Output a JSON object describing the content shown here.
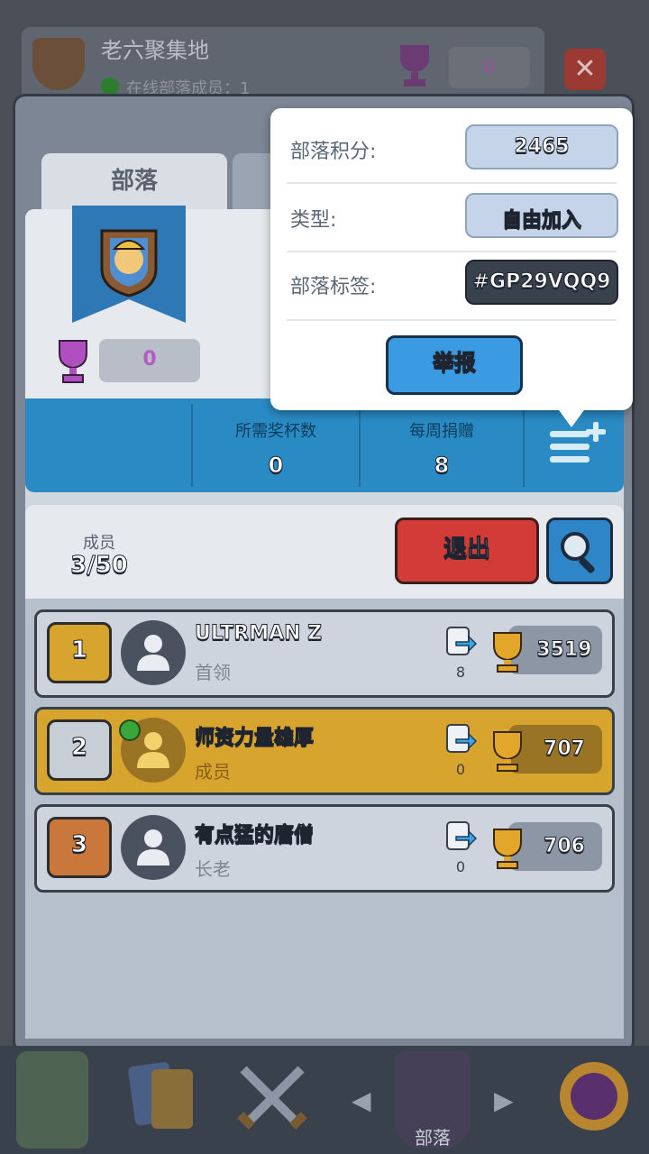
{
  "background": {
    "clan_title": "老六聚集地",
    "online_text": "在线部落成员：1",
    "trophy_value": "0"
  },
  "tabs": {
    "clan": "部落"
  },
  "clan": {
    "trophy_value": "0"
  },
  "stats": [
    {
      "label": "所需奖杯数",
      "value": "0"
    },
    {
      "label": "每周捐赠",
      "value": "8"
    }
  ],
  "members_header": {
    "label": "成员",
    "count": "3/50",
    "exit_label": "退出"
  },
  "members": [
    {
      "rank": "1",
      "name": "ULTRMAN Z",
      "role": "首领",
      "donations": "8",
      "trophies": "3519",
      "online": false
    },
    {
      "rank": "2",
      "name": "师资力量雄厚",
      "role": "成员",
      "donations": "0",
      "trophies": "707",
      "online": true
    },
    {
      "rank": "3",
      "name": "有点猛的唐僧",
      "role": "长老",
      "donations": "0",
      "trophies": "706",
      "online": false
    }
  ],
  "popup": {
    "score_label": "部落积分:",
    "score_value": "2465",
    "type_label": "类型:",
    "type_value": "自由加入",
    "tag_label": "部落标签:",
    "tag_value": "#GP29VQQ9",
    "report_label": "举报"
  },
  "nav": {
    "active_label": "部落"
  },
  "colors": {
    "accent_blue": "#2a8bc4",
    "exit_red": "#d33b36",
    "highlight_gold": "#d7a52e"
  }
}
